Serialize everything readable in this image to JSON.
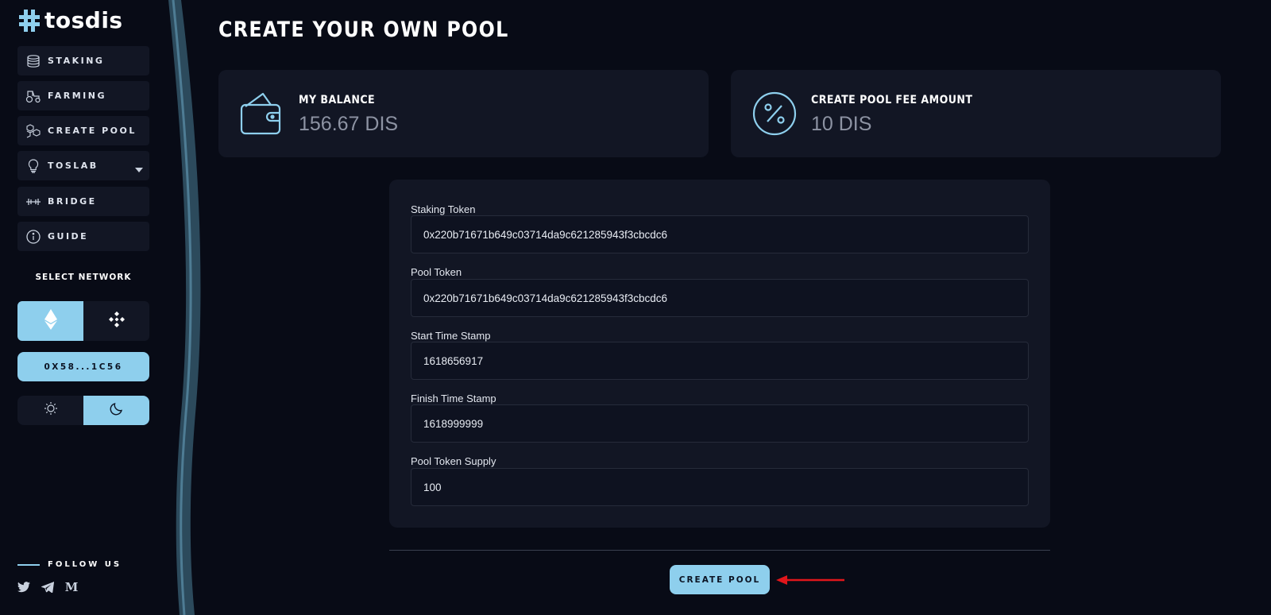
{
  "brand": {
    "name": "tosdis"
  },
  "sidebar": {
    "items": [
      {
        "label": "STAKING",
        "icon": "coins-icon"
      },
      {
        "label": "FARMING",
        "icon": "tractor-icon"
      },
      {
        "label": "CREATE POOL",
        "icon": "cubes-icon"
      },
      {
        "label": "TOSLAB",
        "icon": "lightbulb-icon",
        "has_dropdown": true
      },
      {
        "label": "BRIDGE",
        "icon": "bridge-icon"
      },
      {
        "label": "GUIDE",
        "icon": "info-icon"
      }
    ],
    "select_network_label": "SELECT NETWORK",
    "networks": [
      {
        "name": "ethereum",
        "icon": "ethereum-icon",
        "active": true
      },
      {
        "name": "binance",
        "icon": "binance-icon",
        "active": false
      }
    ],
    "wallet_address": "0X58...1C56",
    "theme": {
      "light_icon": "sun-icon",
      "dark_icon": "moon-icon",
      "active": "dark"
    },
    "follow_label": "FOLLOW US",
    "socials": [
      {
        "icon": "twitter-icon"
      },
      {
        "icon": "telegram-icon"
      },
      {
        "icon": "medium-icon",
        "text": "M"
      }
    ]
  },
  "main": {
    "title": "CREATE YOUR OWN POOL",
    "balance_card": {
      "label": "MY BALANCE",
      "value": "156.67 DIS",
      "icon": "wallet-icon"
    },
    "fee_card": {
      "label": "CREATE POOL FEE AMOUNT",
      "value": "10 DIS",
      "icon": "percent-icon"
    },
    "form": {
      "fields": [
        {
          "label": "Staking Token",
          "value": "0x220b71671b649c03714da9c621285943f3cbcdc6"
        },
        {
          "label": "Pool Token",
          "value": "0x220b71671b649c03714da9c621285943f3cbcdc6"
        },
        {
          "label": "Start Time Stamp",
          "value": "1618656917"
        },
        {
          "label": "Finish Time Stamp",
          "value": "1618999999"
        },
        {
          "label": "Pool Token Supply",
          "value": "100"
        }
      ]
    },
    "create_button_label": "CREATE POOL"
  },
  "colors": {
    "background": "#080b16",
    "card": "#121624",
    "accent": "#8ecfed",
    "annotation_arrow": "#e0161b"
  }
}
